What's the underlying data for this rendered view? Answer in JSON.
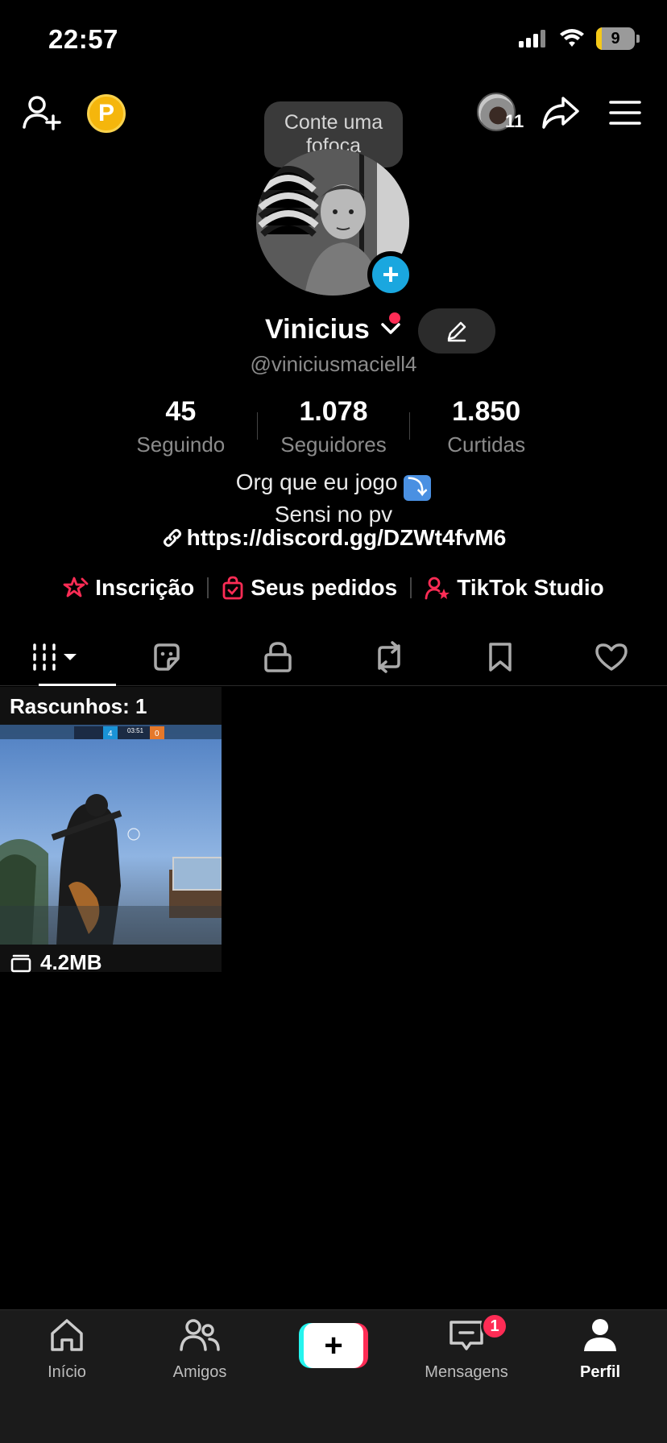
{
  "status_bar": {
    "time": "22:57",
    "battery": "9"
  },
  "top_bar": {
    "coin_label": "P",
    "tooltip_text": "Conte uma fofoca",
    "visitors_count": "11"
  },
  "profile": {
    "name": "Vinicius",
    "handle": "@viniciusmaciell4",
    "stats": [
      {
        "value": "45",
        "label": "Seguindo"
      },
      {
        "value": "1.078",
        "label": "Seguidores"
      },
      {
        "value": "1.850",
        "label": "Curtidas"
      }
    ],
    "bio_line1": "Org que eu jogo",
    "bio_emoji": "⤵",
    "bio_line2": "Sensi no pv",
    "link": "https://discord.gg/DZWt4fvM6"
  },
  "shortcuts": [
    {
      "label": "Inscrição",
      "icon": "star-badge-icon"
    },
    {
      "label": "Seus pedidos",
      "icon": "shopping-bag-icon"
    },
    {
      "label": "TikTok Studio",
      "icon": "person-star-icon"
    }
  ],
  "tabs": [
    {
      "icon": "grid-icon"
    },
    {
      "icon": "sticker-icon"
    },
    {
      "icon": "lock-icon"
    },
    {
      "icon": "repost-icon"
    },
    {
      "icon": "bookmark-icon"
    },
    {
      "icon": "heart-icon"
    }
  ],
  "drafts": {
    "title": "Rascunhos: 1",
    "size": "4.2MB",
    "thumb_left_score": "4",
    "thumb_timer": "03:51",
    "thumb_right_score": "0"
  },
  "bottom_nav": {
    "items": [
      {
        "label": "Início",
        "icon": "home-icon"
      },
      {
        "label": "Amigos",
        "icon": "friends-icon"
      },
      {
        "label": "",
        "icon": "plus-icon"
      },
      {
        "label": "Mensagens",
        "icon": "inbox-icon"
      },
      {
        "label": "Perfil",
        "icon": "profile-icon"
      }
    ],
    "messages_badge": "1"
  },
  "colors": {
    "accent": "#fe2c55",
    "cyan": "#25f4ee",
    "blue_badge": "#1aa7df",
    "coin": "#f5b60c"
  }
}
